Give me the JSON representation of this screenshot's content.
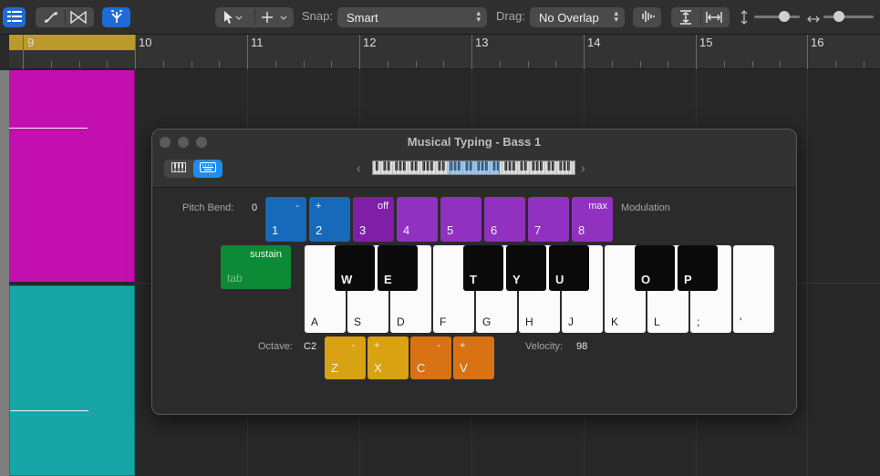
{
  "toolbar": {
    "snap_label": "Snap:",
    "snap_value": "Smart",
    "drag_label": "Drag:",
    "drag_value": "No Overlap"
  },
  "ruler": {
    "bars": [
      "9",
      "10",
      "11",
      "12",
      "13",
      "14",
      "15",
      "16"
    ]
  },
  "musical_typing": {
    "title": "Musical Typing - Bass 1",
    "pitch_bend_label": "Pitch Bend:",
    "pitch_bend_value": "0",
    "modulation_label": "Modulation",
    "octave_label": "Octave:",
    "octave_value": "C2",
    "velocity_label": "Velocity:",
    "velocity_value": "98",
    "sustain": {
      "top": "sustain",
      "key": "tab"
    },
    "number_keys": [
      {
        "top": "-",
        "key": "1"
      },
      {
        "top": "+",
        "key": "2"
      },
      {
        "top": "off",
        "key": "3"
      },
      {
        "top": "",
        "key": "4"
      },
      {
        "top": "",
        "key": "5"
      },
      {
        "top": "",
        "key": "6"
      },
      {
        "top": "",
        "key": "7"
      },
      {
        "top": "max",
        "key": "8"
      }
    ],
    "octave_keys": [
      {
        "top": "-",
        "key": "Z"
      },
      {
        "top": "+",
        "key": "X"
      }
    ],
    "velocity_keys": [
      {
        "top": "-",
        "key": "C"
      },
      {
        "top": "+",
        "key": "V"
      }
    ],
    "white_keys": [
      "A",
      "S",
      "D",
      "F",
      "G",
      "H",
      "J",
      "K",
      "L",
      ";",
      "'"
    ],
    "black_keys": [
      "W",
      "E",
      "T",
      "Y",
      "U",
      "O",
      "P"
    ]
  },
  "colors": {
    "accent": "#1e8cf0",
    "region_magenta": "#c40fb0",
    "region_teal": "#17a6a6",
    "cycle": "#b99a2a"
  }
}
